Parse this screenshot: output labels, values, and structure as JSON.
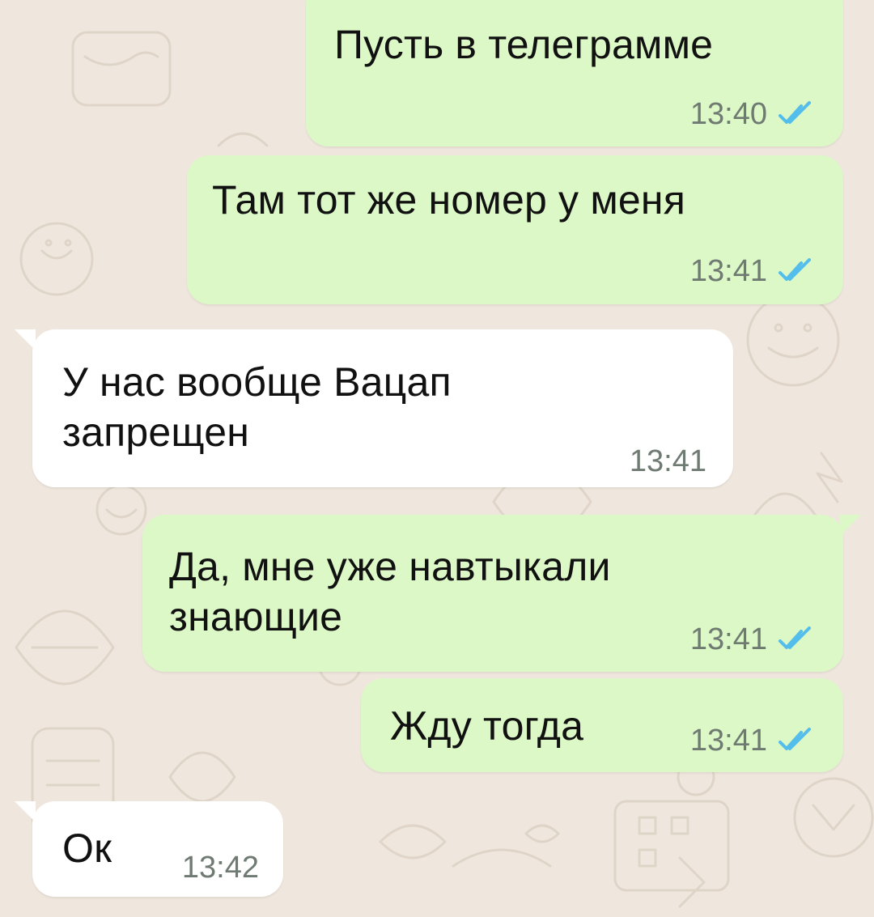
{
  "colors": {
    "wallpaper": "#efe7dd",
    "outgoing_bubble": "#dbf8c6",
    "incoming_bubble": "#ffffff",
    "read_ticks": "#53bdeb",
    "timestamp": "#6f7a72"
  },
  "messages": [
    {
      "direction": "outgoing",
      "lines": [
        "Пусть в телеграмме"
      ],
      "time": "13:40",
      "status": "read"
    },
    {
      "direction": "outgoing",
      "lines": [
        "Там тот же номер у меня"
      ],
      "time": "13:41",
      "status": "read"
    },
    {
      "direction": "incoming",
      "lines": [
        "У нас вообще Вацап",
        "запрещен"
      ],
      "time": "13:41"
    },
    {
      "direction": "outgoing",
      "lines": [
        "Да, мне уже навтыкали",
        "знающие"
      ],
      "time": "13:41",
      "status": "read"
    },
    {
      "direction": "outgoing",
      "lines": [
        "Жду тогда"
      ],
      "time": "13:41",
      "status": "read"
    },
    {
      "direction": "incoming",
      "lines": [
        "Ок"
      ],
      "time": "13:42"
    }
  ]
}
